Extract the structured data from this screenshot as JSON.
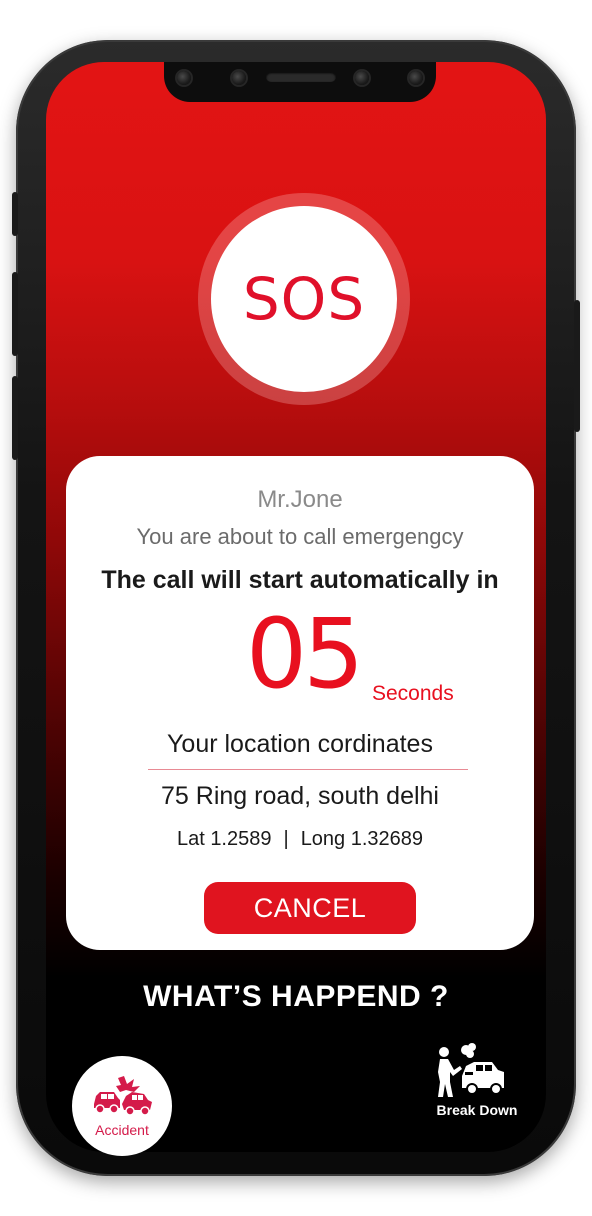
{
  "sos": {
    "label": "SOS"
  },
  "card": {
    "name": "Mr.Jone",
    "subtitle": "You are about to call emergengcy",
    "auto_text": "The call will start automatically in",
    "countdown": "05",
    "countdown_unit": "Seconds",
    "location_label": "Your location cordinates",
    "address": "75 Ring road, south delhi",
    "lat": "Lat 1.2589",
    "separator": "|",
    "long": "Long 1.32689",
    "cancel_label": "CANCEL"
  },
  "happened": {
    "title": "WHAT’S HAPPEND ?",
    "options": [
      {
        "label": "Accident",
        "icon": "car-crash-icon"
      },
      {
        "label": "Break Down",
        "icon": "car-breakdown-icon"
      }
    ]
  },
  "colors": {
    "accent": "#e0141f",
    "countdown": "#e8101f",
    "accident_label": "#d41b4a",
    "bg_top": "#e31414",
    "bg_bottom": "#000000"
  }
}
